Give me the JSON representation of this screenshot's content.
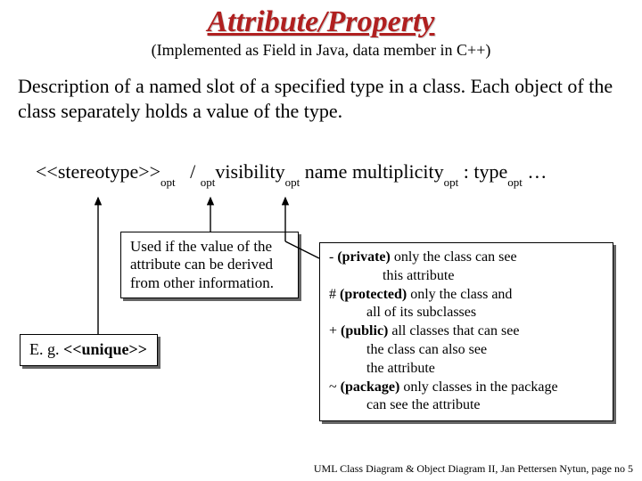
{
  "title": "Attribute/Property",
  "subtitle": "(Implemented as Field in Java, data member in C++)",
  "description": "Description of a named slot of a specified type in a class. Each object of the class separately holds a value of the type.",
  "syntax": {
    "stereotype": "<<stereotype>>",
    "opt1": "opt",
    "slash": "/",
    "opt2": "opt",
    "visibility": "visibility",
    "opt3": "opt",
    "name": " name multiplicity",
    "opt4": "opt",
    "colon_type": " : type",
    "opt5": "opt",
    "ellipsis": " …"
  },
  "box_derived": "Used if the value of the attribute can be derived from other information.",
  "box_example_prefix": "E. g. ",
  "box_example_bold": "<<unique>>",
  "visibility": {
    "private_sym": "- ",
    "private_label": "(private)",
    "private_text": " only the class can see",
    "private_text2": "this attribute",
    "protected_sym": "# ",
    "protected_label": "(protected)",
    "protected_text": " only the class and",
    "protected_text2": "all of its subclasses",
    "public_sym": "+ ",
    "public_label": "(public)",
    "public_text": " all classes that can see",
    "public_text2": "the class can also see",
    "public_text3": "the attribute",
    "package_sym": "~ ",
    "package_label": "(package)",
    "package_text": " only classes in the package",
    "package_text2": "can see the attribute"
  },
  "footer": "UML Class Diagram & Object Diagram II, Jan Pettersen Nytun, page no 5"
}
